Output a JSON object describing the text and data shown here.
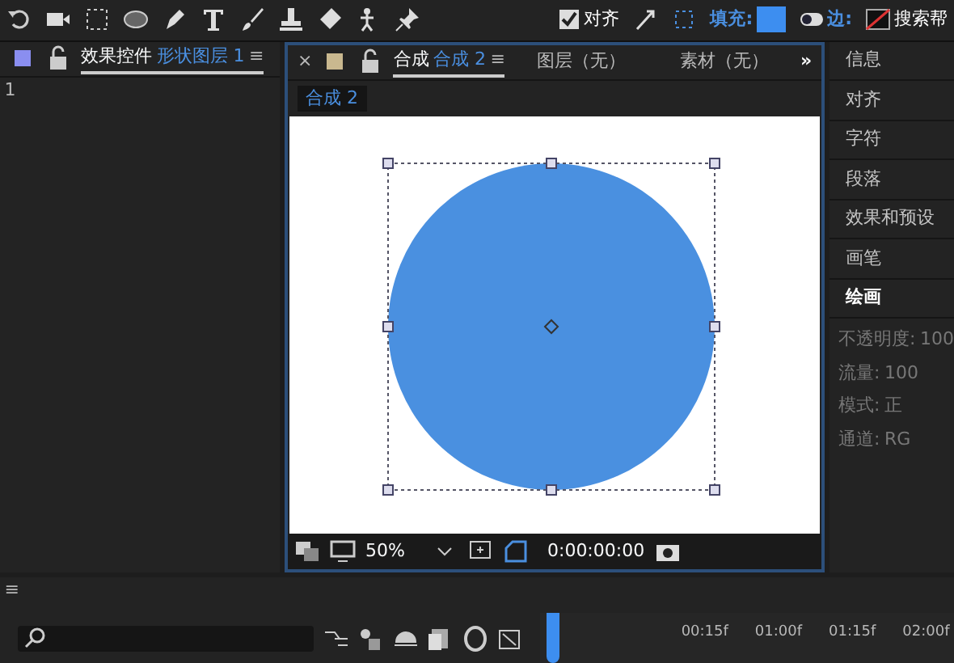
{
  "toolbar": {
    "align": {
      "label": "对齐",
      "checked": true
    },
    "fill_label": "填充:",
    "stroke_label": "边:",
    "search_label": "搜索帮"
  },
  "effects_panel": {
    "title": "效果控件",
    "layer": "形状图层 1",
    "menu": "≡",
    "row": "1"
  },
  "comp_panel": {
    "close": "×",
    "title": "合成",
    "comp": "合成 2",
    "menu": "≡",
    "tabs": [
      {
        "label": "图层（无）"
      },
      {
        "label": "素材（无）"
      }
    ],
    "more": "»",
    "subtab": "合成 2",
    "zoom": "50%",
    "timecode": "0:00:00:00"
  },
  "right_panel": {
    "items": [
      {
        "label": "信息",
        "expanded": false
      },
      {
        "label": "对齐",
        "expanded": false
      },
      {
        "label": "字符",
        "expanded": false
      },
      {
        "label": "段落",
        "expanded": false
      },
      {
        "label": "效果和预设",
        "expanded": false
      },
      {
        "label": "画笔",
        "expanded": false
      },
      {
        "label": "绘画",
        "expanded": true
      }
    ],
    "properties": [
      {
        "label": "不透明度:",
        "value": "100"
      },
      {
        "label": "流量:",
        "value": "100"
      },
      {
        "label": "模式:",
        "value": "正"
      },
      {
        "label": "通道:",
        "value": "RG"
      }
    ]
  },
  "timeline": {
    "menu": "≡",
    "ruler": [
      "00:15f",
      "01:00f",
      "01:15f",
      "02:00f"
    ]
  }
}
